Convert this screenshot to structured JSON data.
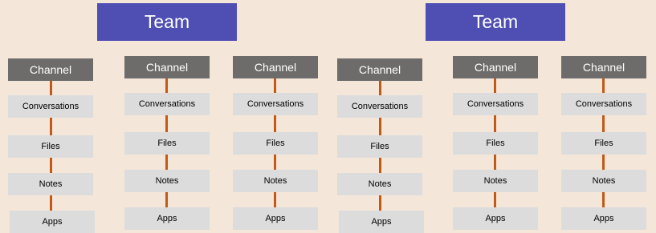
{
  "teams": [
    {
      "label": "Team",
      "channels": [
        {
          "label": "Channel",
          "items": [
            "Conversations",
            "Files",
            "Notes",
            "Apps"
          ]
        },
        {
          "label": "Channel",
          "items": [
            "Conversations",
            "Files",
            "Notes",
            "Apps"
          ]
        },
        {
          "label": "Channel",
          "items": [
            "Conversations",
            "Files",
            "Notes",
            "Apps"
          ]
        }
      ]
    },
    {
      "label": "Team",
      "channels": [
        {
          "label": "Channel",
          "items": [
            "Conversations",
            "Files",
            "Notes",
            "Apps"
          ]
        },
        {
          "label": "Channel",
          "items": [
            "Conversations",
            "Files",
            "Notes",
            "Apps"
          ]
        },
        {
          "label": "Channel",
          "items": [
            "Conversations",
            "Files",
            "Notes",
            "Apps"
          ]
        }
      ]
    }
  ]
}
